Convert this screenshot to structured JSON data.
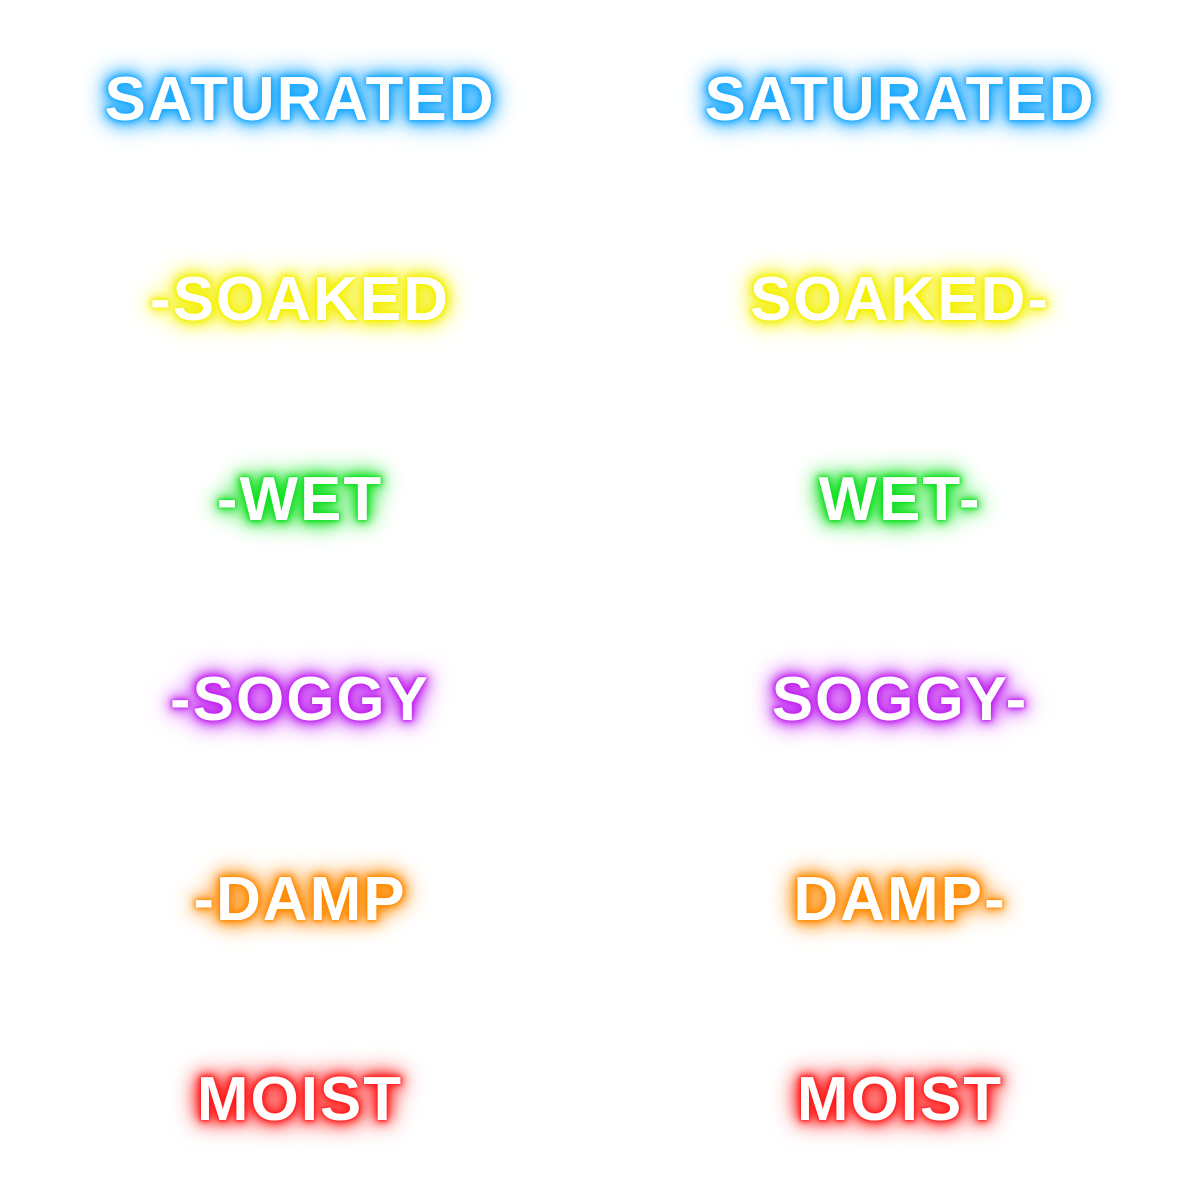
{
  "labels": [
    {
      "left": "SATURATED",
      "right": "SATURATED",
      "glow": "#1aa8ff"
    },
    {
      "left": "-SOAKED",
      "right": "SOAKED-",
      "glow": "#f4f000"
    },
    {
      "left": "-WET",
      "right": "WET-",
      "glow": "#10e020"
    },
    {
      "left": "-SOGGY",
      "right": "SOGGY-",
      "glow": "#c020f0"
    },
    {
      "left": "-DAMP",
      "right": "DAMP-",
      "glow": "#ff8a00"
    },
    {
      "left": "MOIST",
      "right": "MOIST",
      "glow": "#ff1a1a"
    }
  ]
}
